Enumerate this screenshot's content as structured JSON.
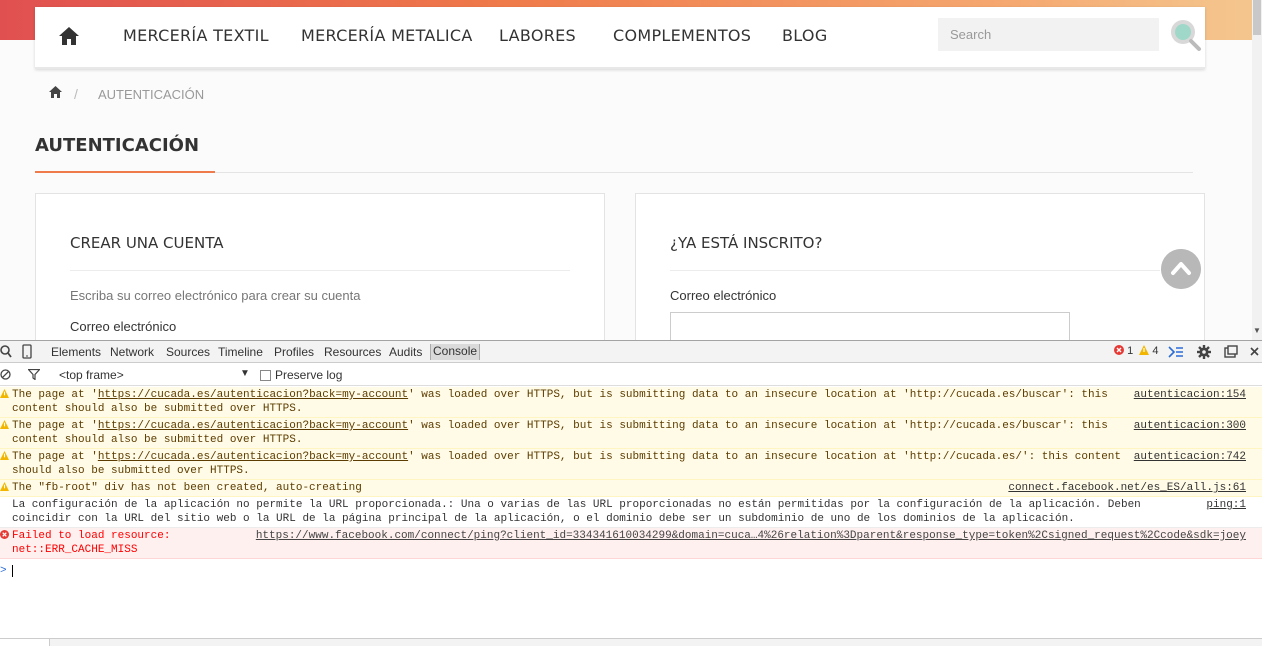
{
  "site": {
    "nav": {
      "links": [
        "MERCERÍA TEXTIL",
        "MERCERÍA METALICA",
        "LABORES",
        "COMPLEMENTOS",
        "BLOG"
      ],
      "search_placeholder": "Search"
    },
    "breadcrumb": {
      "separator": "/",
      "current": "AUTENTICACIÓN"
    },
    "page_title": "AUTENTICACIÓN",
    "create": {
      "title": "CREAR UNA CUENTA",
      "hint": "Escriba su correo electrónico para crear su cuenta",
      "email_label": "Correo electrónico"
    },
    "login": {
      "title": "¿YA ESTÁ INSCRITO?",
      "email_label": "Correo electrónico"
    },
    "colors": {
      "accent": "#ef7a4a",
      "gradient_start": "#e05050",
      "gradient_end": "#f4c890"
    }
  },
  "devtools": {
    "tabs": [
      "Elements",
      "Network",
      "Sources",
      "Timeline",
      "Profiles",
      "Resources",
      "Audits",
      "Console"
    ],
    "active_tab": "Console",
    "error_count": "1",
    "warning_count": "4",
    "frame_select": "<top frame>",
    "preserve_log": "Preserve log",
    "messages": [
      {
        "level": "warn",
        "pre": "The page at '",
        "link": "https://cucada.es/autenticacion?back=my-account",
        "post": "' was loaded over HTTPS, but is submitting data to an insecure location at 'http://cucada.es/buscar': this content should also be submitted over HTTPS.",
        "source": "autenticacion:154"
      },
      {
        "level": "warn",
        "pre": "The page at '",
        "link": "https://cucada.es/autenticacion?back=my-account",
        "post": "' was loaded over HTTPS, but is submitting data to an insecure location at 'http://cucada.es/buscar': this content should also be submitted over HTTPS.",
        "source": "autenticacion:300"
      },
      {
        "level": "warn",
        "pre": "The page at '",
        "link": "https://cucada.es/autenticacion?back=my-account",
        "post": "' was loaded over HTTPS, but is submitting data to an insecure location at 'http://cucada.es/': this content should also be submitted over HTTPS.",
        "source": "autenticacion:742"
      },
      {
        "level": "warn",
        "pre": "The \"fb-root\" div has not been created, auto-creating",
        "link": "",
        "post": "",
        "source": "connect.facebook.net/es_ES/all.js:61"
      },
      {
        "level": "log",
        "pre": "La configuración de la aplicación no permite la URL proporcionada.: Una o varias de las URL proporcionadas no están permitidas por la configuración de la aplicación. Deben coincidir con la URL del sitio web o la URL de la página principal de la aplicación, o el dominio debe ser un subdominio de uno de los dominios de la aplicación.",
        "link": "",
        "post": "",
        "source": "ping:1"
      },
      {
        "level": "err",
        "pre": "Failed to load resource: ",
        "link": "",
        "post": "net::ERR_CACHE_MISS",
        "source": "https://www.facebook.com/connect/ping?client_id=334341610034299&domain=cuca…4%26relation%3Dparent&response_type=token%2Csigned_request%2Ccode&sdk=joey"
      }
    ],
    "prompt": ">"
  }
}
